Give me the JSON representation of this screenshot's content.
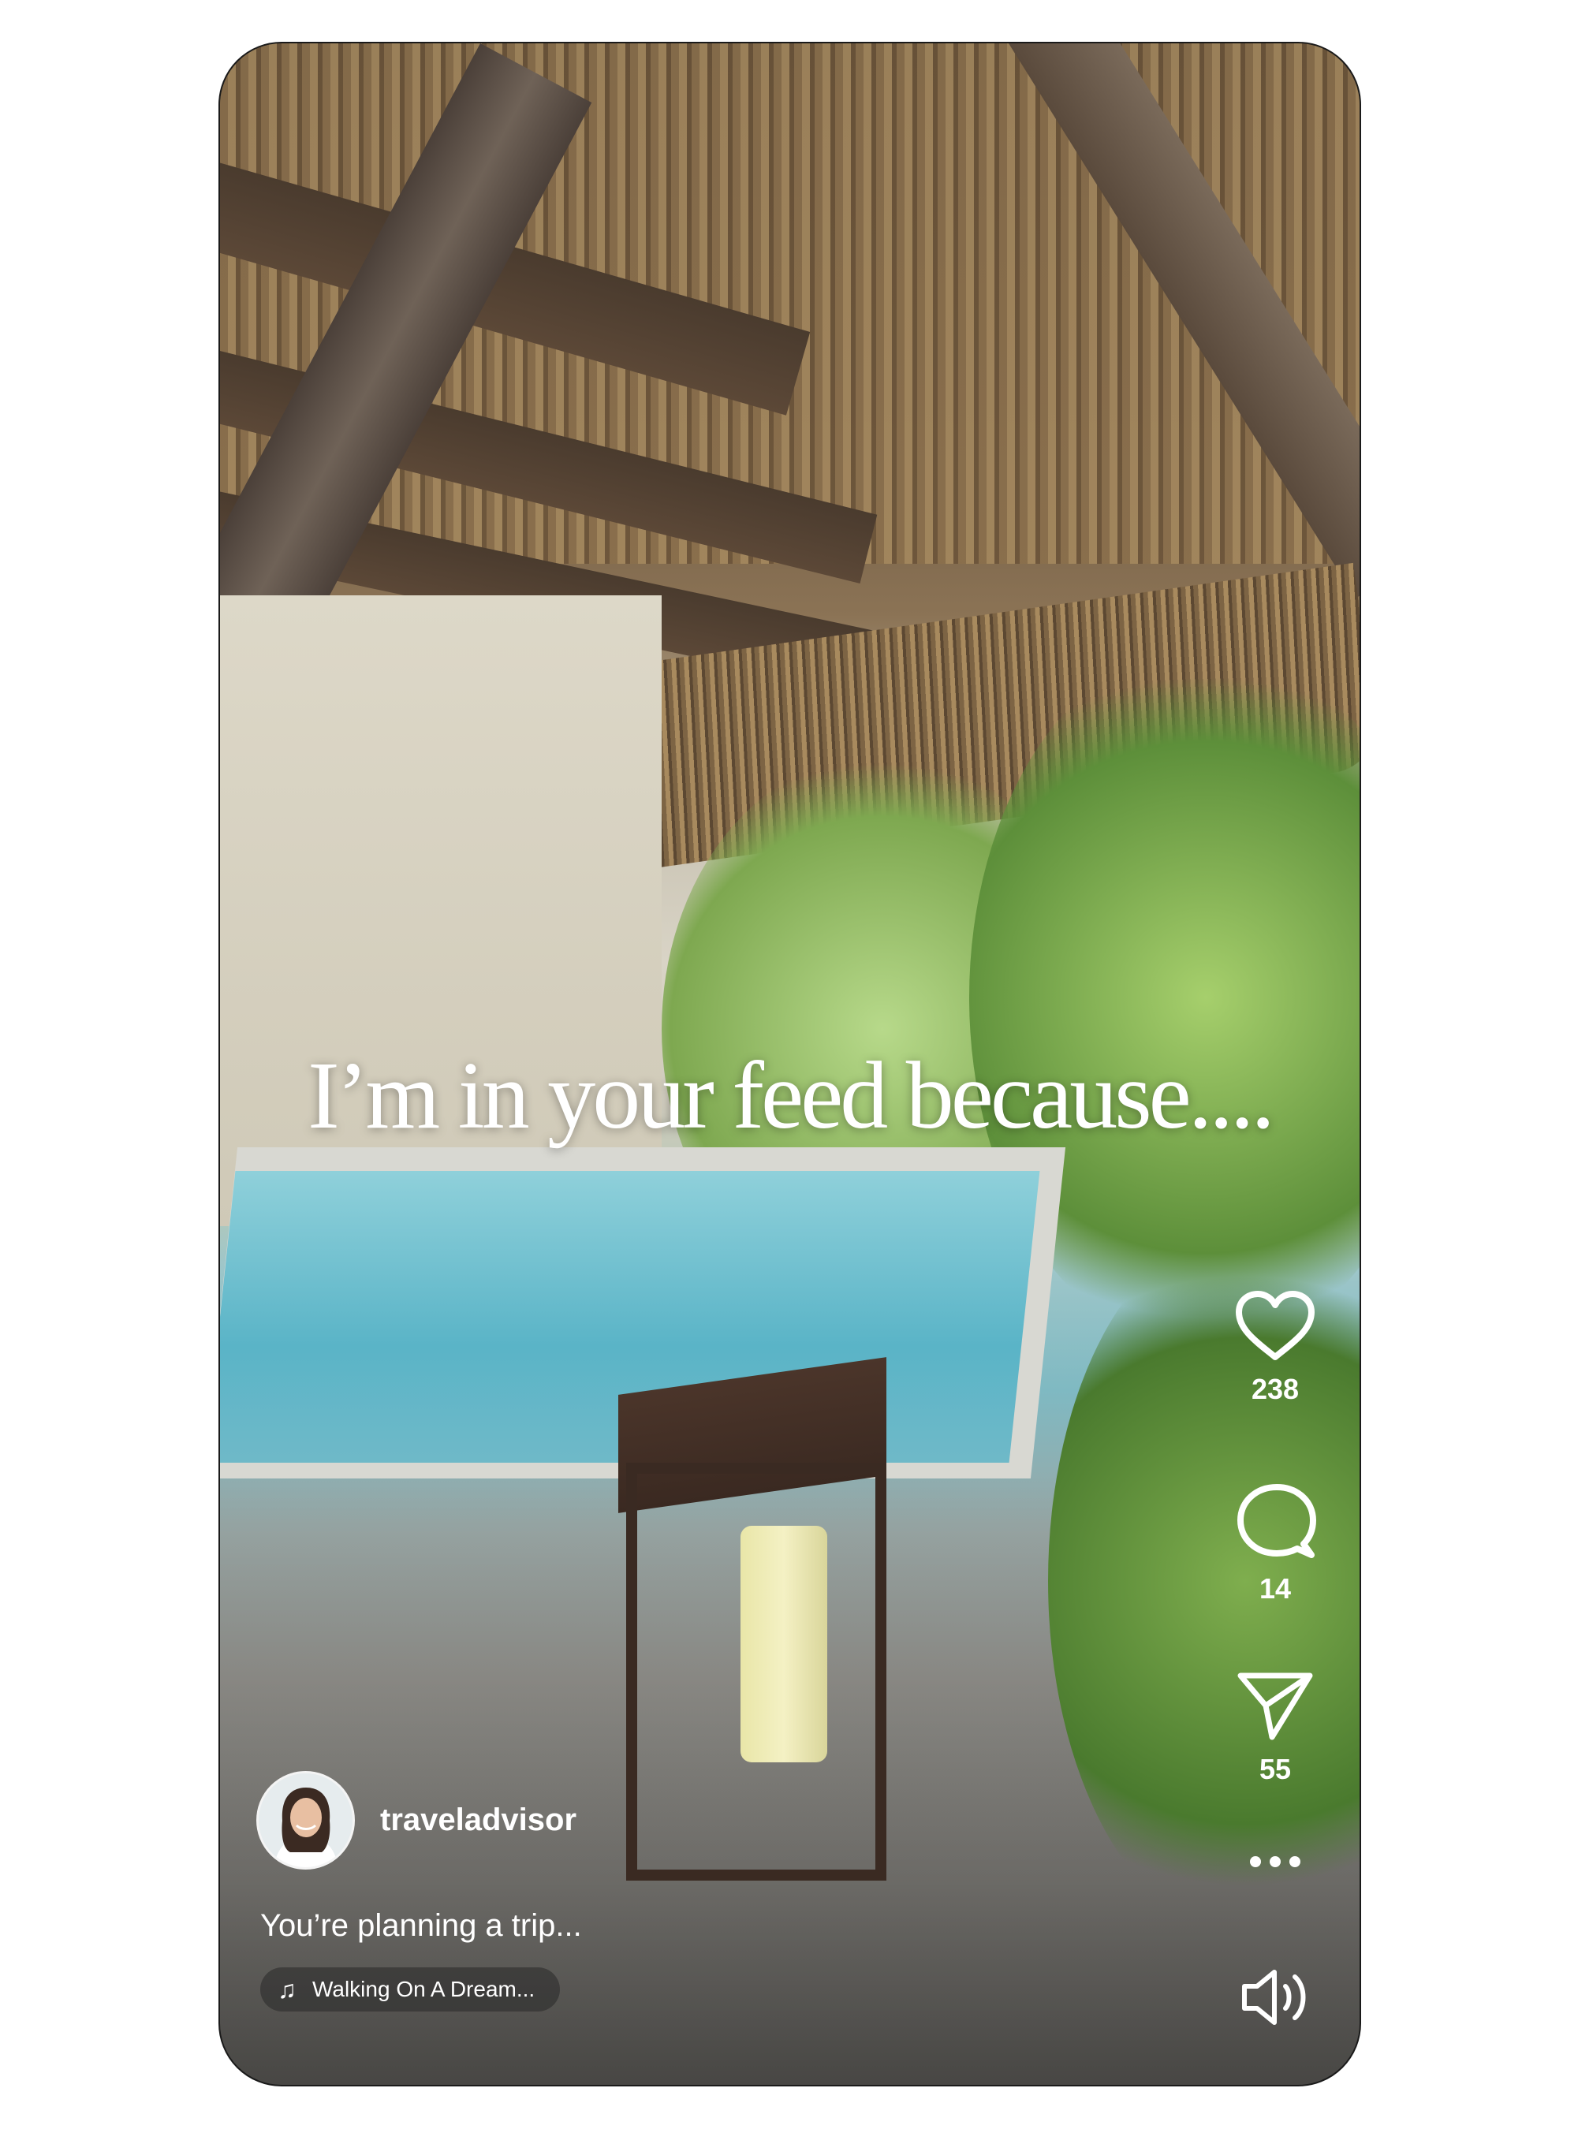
{
  "overlay_text": "I’m in your feed because....",
  "actions": {
    "like_count": "238",
    "comment_count": "14",
    "share_count": "55"
  },
  "profile": {
    "username": "traveladvisor"
  },
  "caption": "You’re planning a trip...",
  "music": {
    "track": "Walking On A Dream..."
  },
  "icons": [
    "heart-icon",
    "comment-icon",
    "share-icon",
    "more-icon",
    "volume-icon",
    "music-note-icon"
  ]
}
